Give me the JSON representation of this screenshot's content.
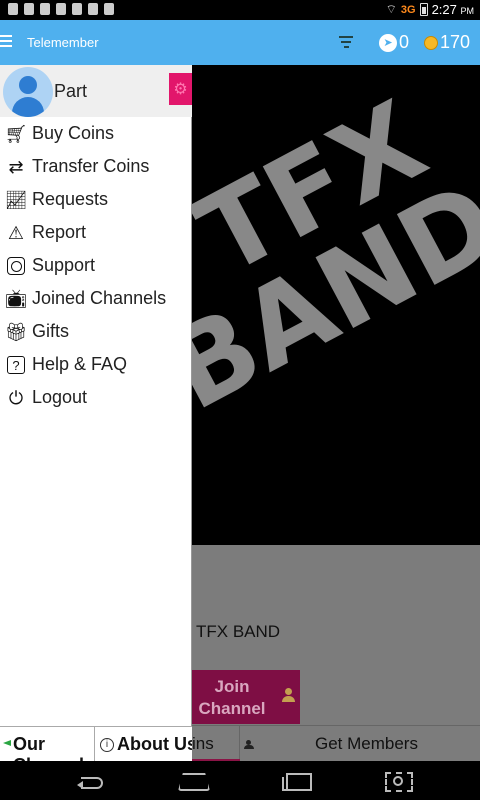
{
  "status_bar": {
    "network": "3G",
    "time": "2:27",
    "ampm": "PM"
  },
  "app_bar": {
    "title": "Telemember",
    "telegram_count": "0",
    "coin_count": "170"
  },
  "background": {
    "logo_line1": "TFX",
    "logo_line2": "BAND",
    "channel_name": "TFX BAND",
    "join_button_label": "Join Channel",
    "tabs": {
      "coins_label": "ins",
      "members_label": "Get Members"
    }
  },
  "drawer": {
    "user_name": "Part",
    "menu": [
      {
        "label": "Buy Coins",
        "icon": "cart-icon"
      },
      {
        "label": "Transfer Coins",
        "icon": "transfer-icon"
      },
      {
        "label": "Requests",
        "icon": "chart-icon"
      },
      {
        "label": "Report",
        "icon": "warning-icon"
      },
      {
        "label": "Support",
        "icon": "support-icon"
      },
      {
        "label": "Joined Channels",
        "icon": "tv-icon"
      },
      {
        "label": "Gifts",
        "icon": "gift-icon"
      },
      {
        "label": "Help & FAQ",
        "icon": "question-icon"
      },
      {
        "label": "Logout",
        "icon": "power-icon"
      }
    ],
    "footer": {
      "our_channel_label": "Our Channel",
      "about_label": "About Us"
    }
  },
  "colors": {
    "app_bar": "#4fb0ee",
    "accent_pink": "#e2166b",
    "join_button": "#7e0e44"
  }
}
